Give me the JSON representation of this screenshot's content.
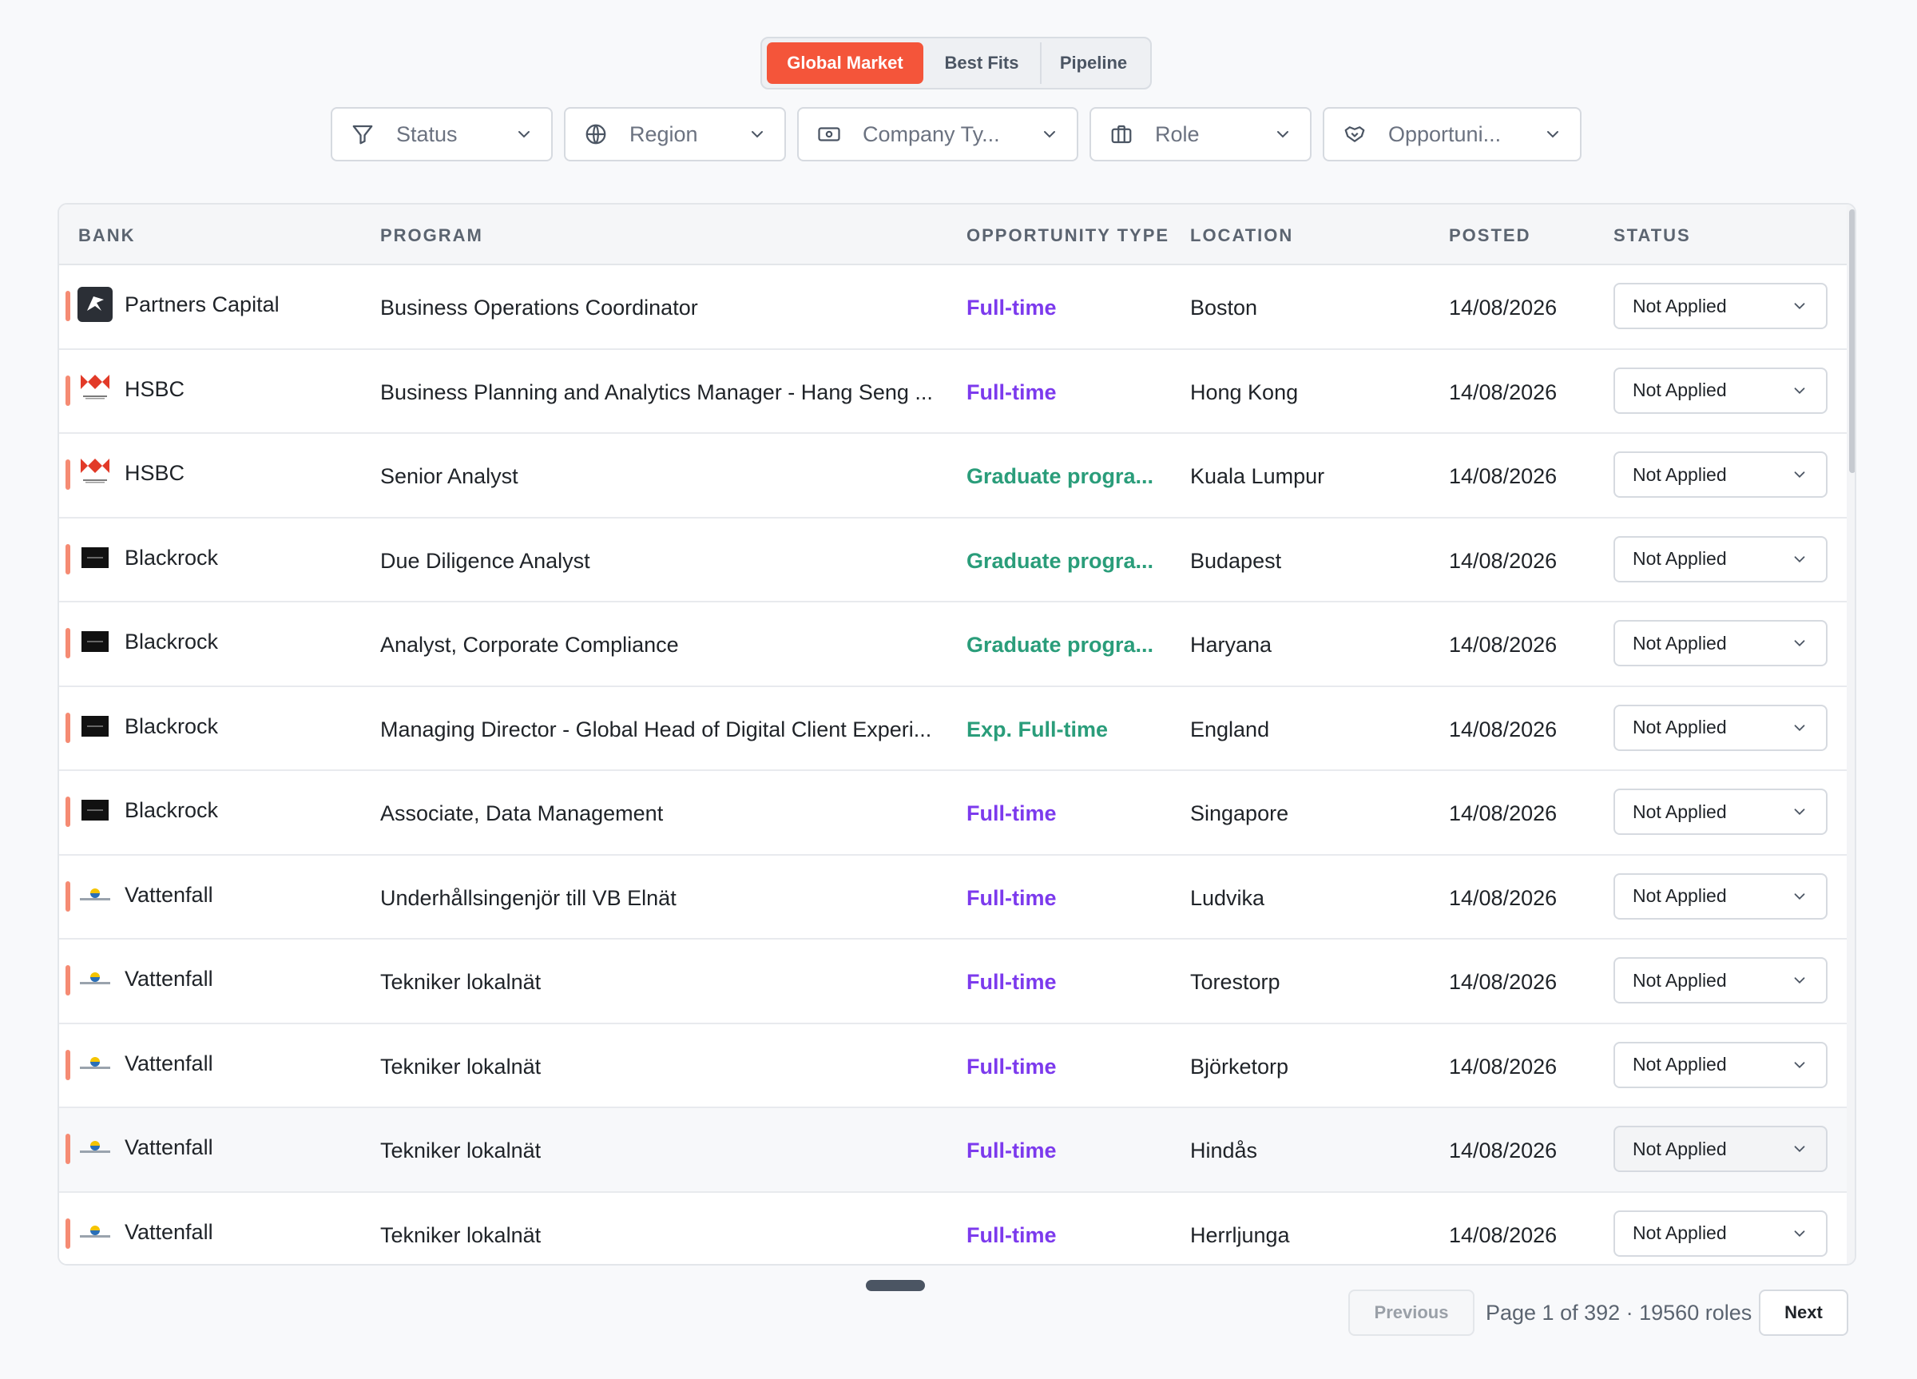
{
  "tabs": [
    {
      "label": "Global Market",
      "active": true
    },
    {
      "label": "Best Fits",
      "active": false
    },
    {
      "label": "Pipeline",
      "active": false
    }
  ],
  "filters": [
    {
      "label": "Status",
      "icon": "filter-icon"
    },
    {
      "label": "Region",
      "icon": "globe-icon"
    },
    {
      "label": "Company Ty...",
      "icon": "banknote-icon"
    },
    {
      "label": "Role",
      "icon": "briefcase-icon"
    },
    {
      "label": "Opportuni...",
      "icon": "handshake-icon"
    }
  ],
  "table": {
    "columns": [
      "BANK",
      "PROGRAM",
      "OPPORTUNITY TYPE",
      "LOCATION",
      "POSTED",
      "STATUS"
    ],
    "rows": [
      {
        "bank": "Partners Capital",
        "logo": "partners-capital-logo",
        "program": "Business Operations Coordinator",
        "type": "Full-time",
        "type_color": "purple",
        "location": "Boston",
        "posted": "14/08/2026",
        "status": "Not Applied"
      },
      {
        "bank": "HSBC",
        "logo": "hsbc-logo",
        "program": "Business Planning and Analytics Manager - Hang Seng ...",
        "type": "Full-time",
        "type_color": "purple",
        "location": "Hong Kong",
        "posted": "14/08/2026",
        "status": "Not Applied"
      },
      {
        "bank": "HSBC",
        "logo": "hsbc-logo",
        "program": "Senior Analyst",
        "type": "Graduate progra...",
        "type_color": "teal",
        "location": "Kuala Lumpur",
        "posted": "14/08/2026",
        "status": "Not Applied"
      },
      {
        "bank": "Blackrock",
        "logo": "blackrock-logo",
        "program": "Due Diligence Analyst",
        "type": "Graduate progra...",
        "type_color": "teal",
        "location": "Budapest",
        "posted": "14/08/2026",
        "status": "Not Applied"
      },
      {
        "bank": "Blackrock",
        "logo": "blackrock-logo",
        "program": "Analyst, Corporate Compliance",
        "type": "Graduate progra...",
        "type_color": "teal",
        "location": "Haryana",
        "posted": "14/08/2026",
        "status": "Not Applied"
      },
      {
        "bank": "Blackrock",
        "logo": "blackrock-logo",
        "program": "Managing Director - Global Head of Digital Client Experi...",
        "type": "Exp. Full-time",
        "type_color": "teal",
        "location": "England",
        "posted": "14/08/2026",
        "status": "Not Applied"
      },
      {
        "bank": "Blackrock",
        "logo": "blackrock-logo",
        "program": "Associate, Data Management",
        "type": "Full-time",
        "type_color": "purple",
        "location": "Singapore",
        "posted": "14/08/2026",
        "status": "Not Applied"
      },
      {
        "bank": "Vattenfall",
        "logo": "vattenfall-logo",
        "program": "Underhållsingenjör till VB Elnät",
        "type": "Full-time",
        "type_color": "purple",
        "location": "Ludvika",
        "posted": "14/08/2026",
        "status": "Not Applied"
      },
      {
        "bank": "Vattenfall",
        "logo": "vattenfall-logo",
        "program": "Tekniker lokalnät",
        "type": "Full-time",
        "type_color": "purple",
        "location": "Torestorp",
        "posted": "14/08/2026",
        "status": "Not Applied"
      },
      {
        "bank": "Vattenfall",
        "logo": "vattenfall-logo",
        "program": "Tekniker lokalnät",
        "type": "Full-time",
        "type_color": "purple",
        "location": "Björketorp",
        "posted": "14/08/2026",
        "status": "Not Applied"
      },
      {
        "bank": "Vattenfall",
        "logo": "vattenfall-logo",
        "program": "Tekniker lokalnät",
        "type": "Full-time",
        "type_color": "purple",
        "location": "Hindås",
        "posted": "14/08/2026",
        "status": "Not Applied",
        "hover": true
      },
      {
        "bank": "Vattenfall",
        "logo": "vattenfall-logo",
        "program": "Tekniker lokalnät",
        "type": "Full-time",
        "type_color": "purple",
        "location": "Herrljunga",
        "posted": "14/08/2026",
        "status": "Not Applied"
      }
    ]
  },
  "pagination": {
    "previous_label": "Previous",
    "info": "Page 1 of 392 · 19560 roles",
    "next_label": "Next"
  },
  "colors": {
    "accent": "#f4553a",
    "type_purple": "#7c3aed",
    "type_teal": "#2a9d7a"
  }
}
